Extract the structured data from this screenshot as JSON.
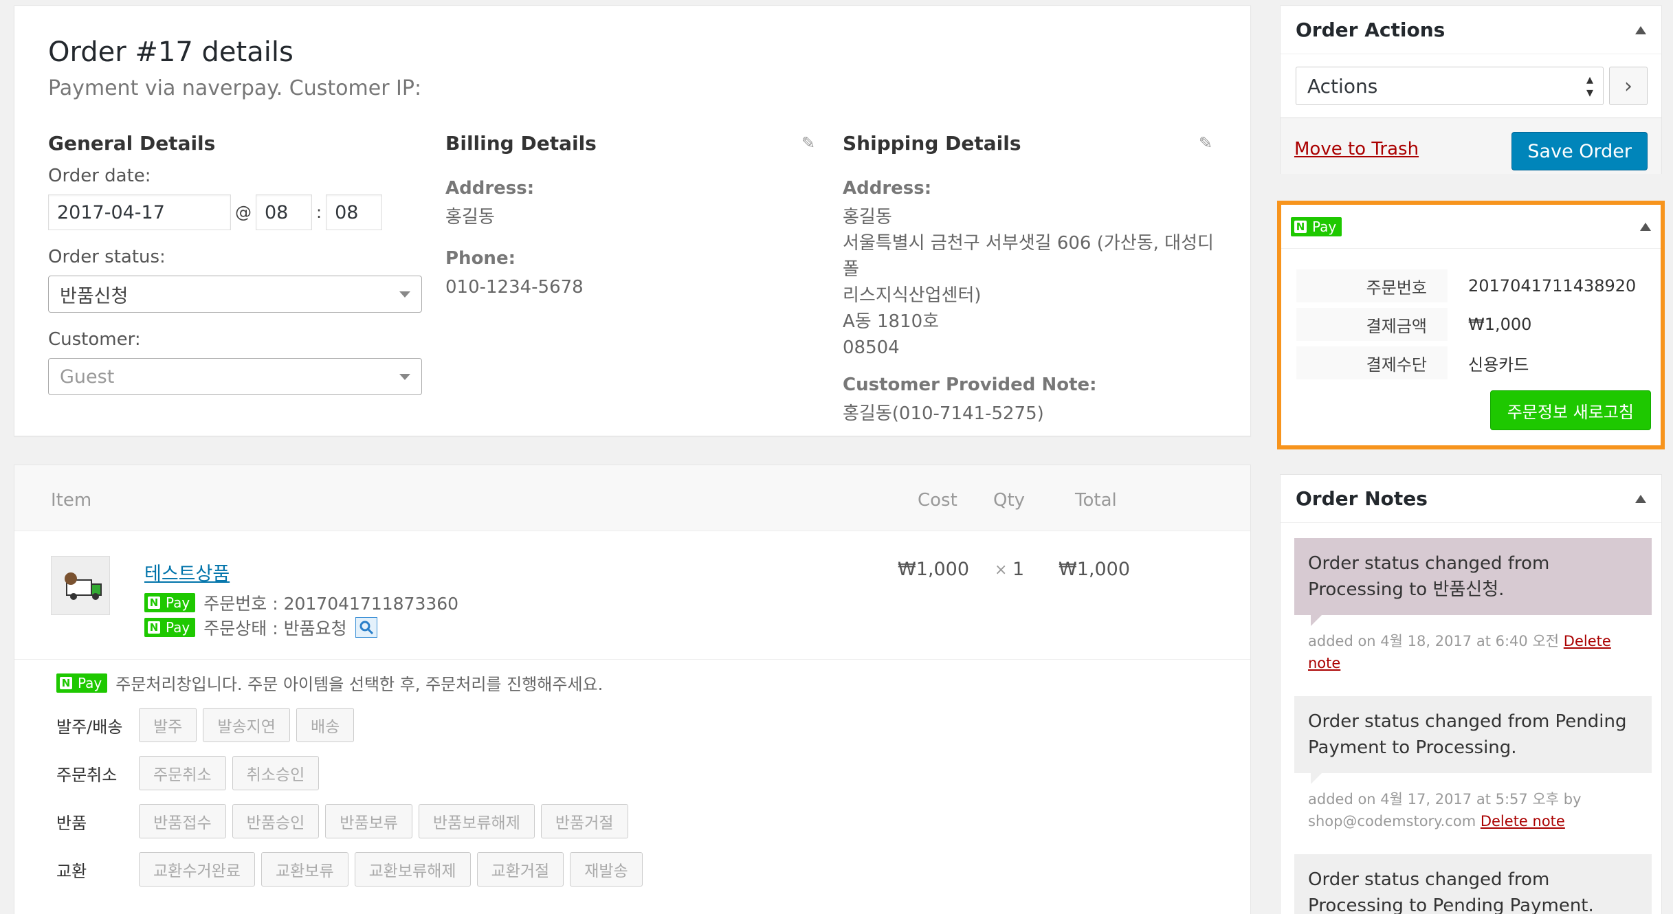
{
  "details": {
    "title": "Order #17 details",
    "subtitle": "Payment via naverpay. Customer IP:",
    "general": {
      "heading": "General Details",
      "order_date_label": "Order date:",
      "date": "2017-04-17",
      "at": "@",
      "hour": "08",
      "colon": ":",
      "minute": "08",
      "status_label": "Order status:",
      "status_value": "반품신청",
      "customer_label": "Customer:",
      "customer_value": "Guest"
    },
    "billing": {
      "heading": "Billing Details",
      "address_label": "Address:",
      "address": "홍길동",
      "phone_label": "Phone:",
      "phone": "010-1234-5678"
    },
    "shipping": {
      "heading": "Shipping Details",
      "address_label": "Address:",
      "address_lines": [
        "홍길동",
        "서울특별시 금천구 서부샛길 606 (가산동, 대성디폴",
        "리스지식산업센터)",
        "A동 1810호",
        "08504"
      ],
      "note_label": "Customer Provided Note:",
      "note": "홍길동(010-7141-5275)"
    }
  },
  "items": {
    "headers": {
      "item": "Item",
      "cost": "Cost",
      "qty": "Qty",
      "total": "Total"
    },
    "row": {
      "name": "테스트상품",
      "order_no": "주문번호 : 2017041711873360",
      "order_state": "주문상태 : 반품요청",
      "cost": "₩1,000",
      "qty_x": "×",
      "qty": "1",
      "total": "₩1,000"
    },
    "npay_label": "Pay",
    "npay_n": "N",
    "process_intro": "주문처리창입니다. 주문 아이템을 선택한 후, 주문처리를 진행해주세요.",
    "process_rows": [
      {
        "label": "발주/배송",
        "buttons": [
          "발주",
          "발송지연",
          "배송"
        ]
      },
      {
        "label": "주문취소",
        "buttons": [
          "주문취소",
          "취소승인"
        ]
      },
      {
        "label": "반품",
        "buttons": [
          "반품접수",
          "반품승인",
          "반품보류",
          "반품보류해제",
          "반품거절"
        ]
      },
      {
        "label": "교환",
        "buttons": [
          "교환수거완료",
          "교환보류",
          "교환보류해제",
          "교환거절",
          "재발송"
        ]
      }
    ]
  },
  "actions": {
    "heading": "Order Actions",
    "select_value": "Actions",
    "go": "›",
    "trash": "Move to Trash",
    "save": "Save Order"
  },
  "npaybox": {
    "rows": [
      {
        "k": "주문번호",
        "v": "2017041711438920"
      },
      {
        "k": "결제금액",
        "v": "₩1,000"
      },
      {
        "k": "결제수단",
        "v": "신용카드"
      }
    ],
    "refresh": "주문정보 새로고침"
  },
  "notes": {
    "heading": "Order Notes",
    "list": [
      {
        "text": "Order status changed from Processing to 반품신청.",
        "meta": "added on 4월 18, 2017 at 6:40 오전",
        "by": "",
        "delete": "Delete note",
        "bg": "#d7cad2"
      },
      {
        "text": "Order status changed from Pending Payment to Processing.",
        "meta": "added on 4월 17, 2017 at 5:57 오후 by",
        "by": "shop@codemstory.com",
        "delete": "Delete note",
        "bg": "#efefef"
      },
      {
        "text": "Order status changed from Processing to Pending Payment.",
        "meta": "",
        "by": "",
        "delete": "",
        "bg": "#efefef"
      }
    ]
  },
  "colors": {
    "accent": "#0085ba",
    "trash": "#a00",
    "npay": "#1ec800",
    "highlight": "#f7941d",
    "note_customer": "#d7cad2"
  }
}
